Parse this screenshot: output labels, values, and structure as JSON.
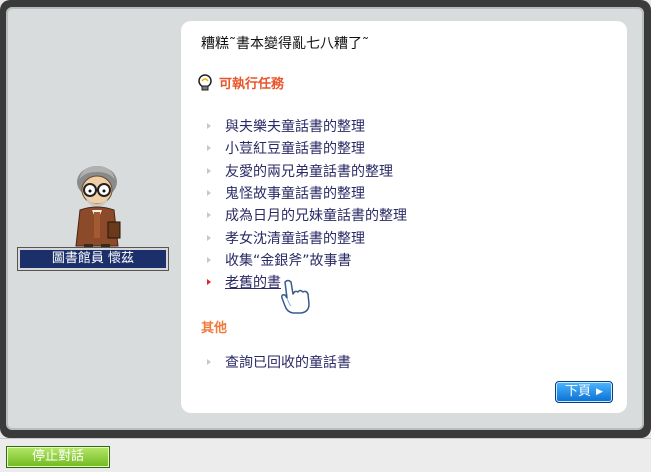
{
  "dialog": {
    "title": "糟糕˜書本變得亂七八糟了˜",
    "quest_section_label": "可執行任務",
    "quest_items": [
      "與夫樂夫童話書的整理",
      "小荳紅豆童話書的整理",
      "友愛的兩兄弟童話書的整理",
      "鬼怪故事童話書的整理",
      "成為日月的兄妹童話書的整理",
      "孝女沈清童話書的整理",
      "收集“金銀斧”故事書",
      "老舊的書"
    ],
    "other_section_label": "其他",
    "other_items": [
      "查詢已回收的童話書"
    ],
    "next_button_label": "下頁",
    "next_button_chevron": "▶"
  },
  "npc": {
    "name": "圖書館員 懷茲"
  },
  "bottom_bar": {
    "stop_button_label": "停止對話"
  },
  "colors": {
    "quest_header": "#e8552a",
    "other_header": "#f07a3c",
    "list_text": "#2a2a66",
    "active_bullet": "#e82020",
    "nameplate_bg": "#1b2f6b",
    "next_button": "#0a6fd4",
    "stop_button": "#6fb91f"
  }
}
